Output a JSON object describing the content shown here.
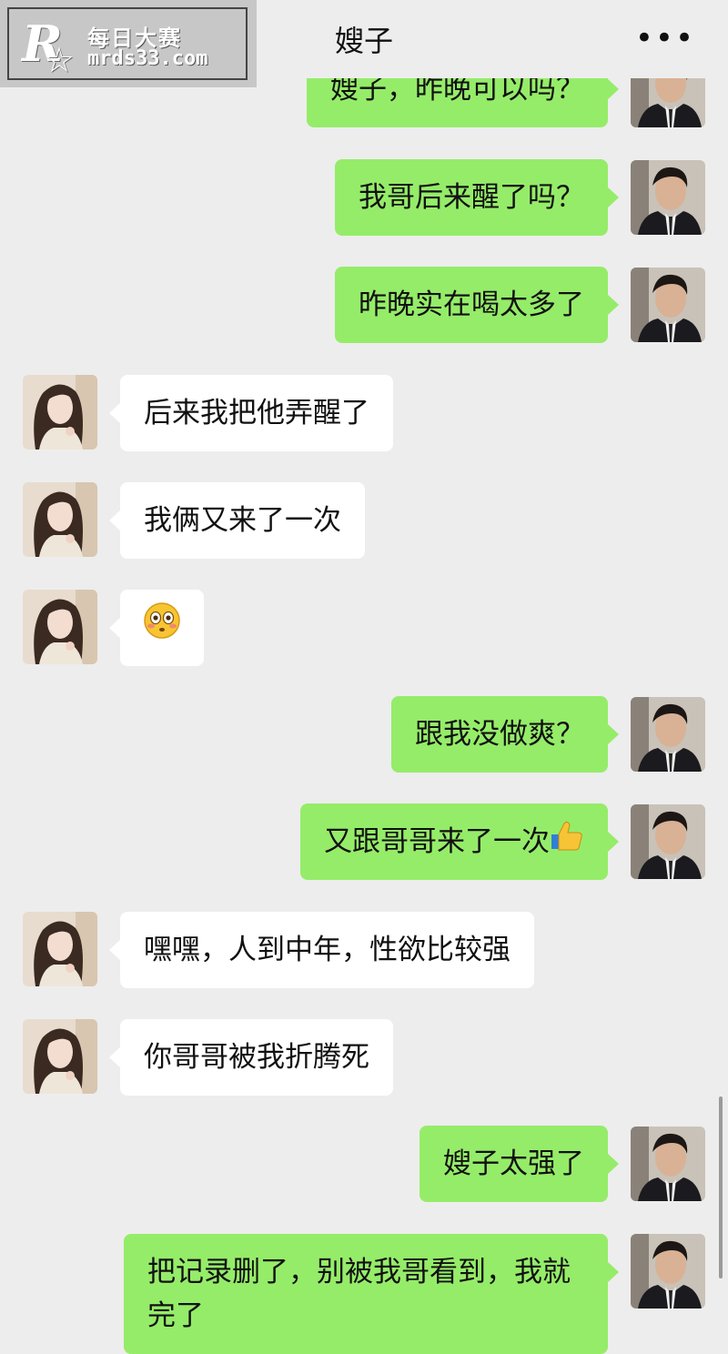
{
  "header": {
    "title": "嫂子",
    "more_label": "•••"
  },
  "watermark": {
    "logo": "R",
    "line1": "每日大赛",
    "line2": "mrds33.com"
  },
  "messages": [
    {
      "side": "out",
      "text": "嫂子，昨晚可以吗？"
    },
    {
      "side": "out",
      "text": "我哥后来醒了吗？"
    },
    {
      "side": "out",
      "text": "昨晚实在喝太多了"
    },
    {
      "side": "in",
      "text": "后来我把他弄醒了"
    },
    {
      "side": "in",
      "text": "我俩又来了一次"
    },
    {
      "side": "in",
      "text": "",
      "emoji": "flushed-face"
    },
    {
      "side": "out",
      "text": "跟我没做爽？"
    },
    {
      "side": "out",
      "text": "又跟哥哥来了一次",
      "emoji": "thumbs-up"
    },
    {
      "side": "in",
      "text": "嘿嘿，人到中年，性欲比较强"
    },
    {
      "side": "in",
      "text": "你哥哥被我折腾死"
    },
    {
      "side": "out",
      "text": "嫂子太强了"
    },
    {
      "side": "out",
      "text": "把记录删了，别被我哥看到，我就完了"
    }
  ],
  "colors": {
    "outgoing_bubble": "#95ec69",
    "incoming_bubble": "#ffffff",
    "background": "#ededed"
  }
}
